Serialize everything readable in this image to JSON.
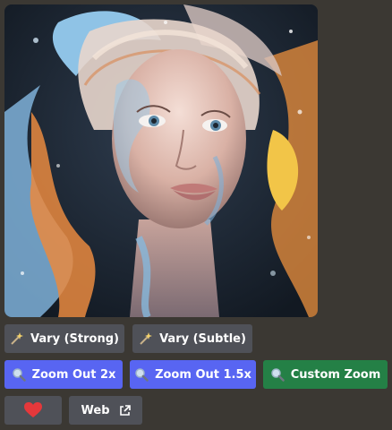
{
  "image": {
    "alt": "AI-generated portrait of a woman with swirling blue, orange and white paint splashes"
  },
  "buttons": {
    "vary_strong": "Vary (Strong)",
    "vary_subtle": "Vary (Subtle)",
    "zoom_out_2x": "Zoom Out 2x",
    "zoom_out_1_5x": "Zoom Out 1.5x",
    "custom_zoom": "Custom Zoom",
    "web": "Web"
  },
  "icons": {
    "vary": "magic-wand-icon",
    "zoom": "magnifier-icon",
    "favorite": "heart-icon",
    "external": "external-link-icon"
  },
  "colors": {
    "background": "#3b3833",
    "secondary_button": "#4f5158",
    "primary_button": "#5865f2",
    "success_button": "#248046",
    "heart": "#e5383b"
  }
}
